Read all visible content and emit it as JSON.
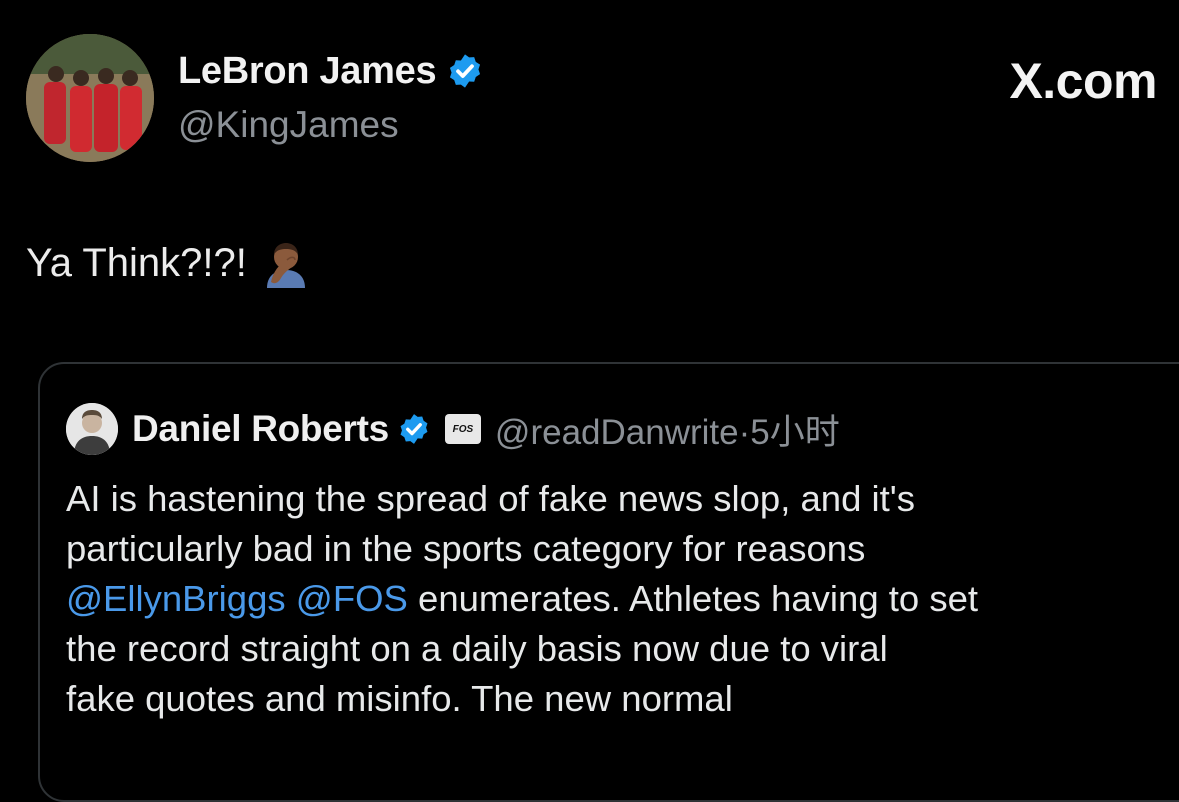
{
  "brand": "X.com",
  "author": {
    "name": "LeBron James",
    "handle": "@KingJames",
    "verified": true,
    "avatar": "group-photo-red-outfits"
  },
  "tweet": {
    "text": "Ya Think?!?!",
    "emoji": "person-facepalming-medium-dark-skin-tone"
  },
  "quoted": {
    "name": "Daniel Roberts",
    "verified": true,
    "affiliate_badge": "FOS",
    "handle": "@readDanwrite",
    "time": "5小时",
    "meta_separator": "·",
    "body": {
      "line1": "AI is hastening the spread of fake news slop, and it's",
      "line2": "particularly bad in the sports category for reasons",
      "mention1": "@EllynBriggs",
      "mention2": "@FOS",
      "line3_rest": " enumerates. Athletes having to set",
      "line4": "the record straight on a daily basis now due to viral",
      "line5": "fake quotes and misinfo. The new normal"
    }
  },
  "colors": {
    "background": "#000000",
    "text": "#e7e9ea",
    "secondary_text": "#8b9096",
    "link": "#4a99e9",
    "verified": "#1d9bf0",
    "quote_border": "#2f3336"
  }
}
